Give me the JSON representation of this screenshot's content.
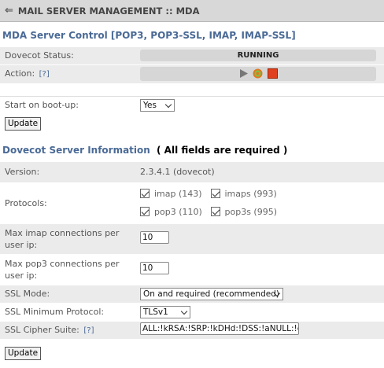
{
  "title": "MAIL SERVER MANAGEMENT :: MDA",
  "control": {
    "heading": "MDA Server Control [POP3, POP3-SSL, IMAP, IMAP-SSL]",
    "status_label": "Dovecot Status:",
    "status_value": "RUNNING",
    "action_label": "Action:",
    "help": "[?]",
    "actions": [
      "start-icon",
      "restart-icon",
      "stop-icon"
    ],
    "colors": {
      "start": "#777777",
      "restart": "#e07a1f",
      "stop": "#e0401f"
    }
  },
  "boot": {
    "label": "Start on boot-up:",
    "value": "Yes",
    "update": "Update"
  },
  "info": {
    "heading": "Dovecot Server Information",
    "required": "( All fields are required )",
    "version_label": "Version:",
    "version_value": "2.3.4.1 (dovecot)",
    "protocols_label": "Protocols:",
    "protocols": [
      {
        "label": "imap (143)",
        "checked": true
      },
      {
        "label": "imaps (993)",
        "checked": true
      },
      {
        "label": "pop3 (110)",
        "checked": true
      },
      {
        "label": "pop3s (995)",
        "checked": true
      }
    ],
    "imap_conn_label": "Max imap connections per user ip:",
    "imap_conn_value": "10",
    "pop3_conn_label": "Max pop3 connections per user ip:",
    "pop3_conn_value": "10",
    "ssl_mode_label": "SSL Mode:",
    "ssl_mode_value": "On and required (recommended)",
    "ssl_proto_label": "SSL Minimum Protocol:",
    "ssl_proto_value": "TLSv1",
    "cipher_label": "SSL Cipher Suite:",
    "cipher_help": "[?]",
    "cipher_value": "ALL:!kRSA:!SRP:!kDHd:!DSS:!aNULL:!eNUL",
    "update": "Update"
  }
}
